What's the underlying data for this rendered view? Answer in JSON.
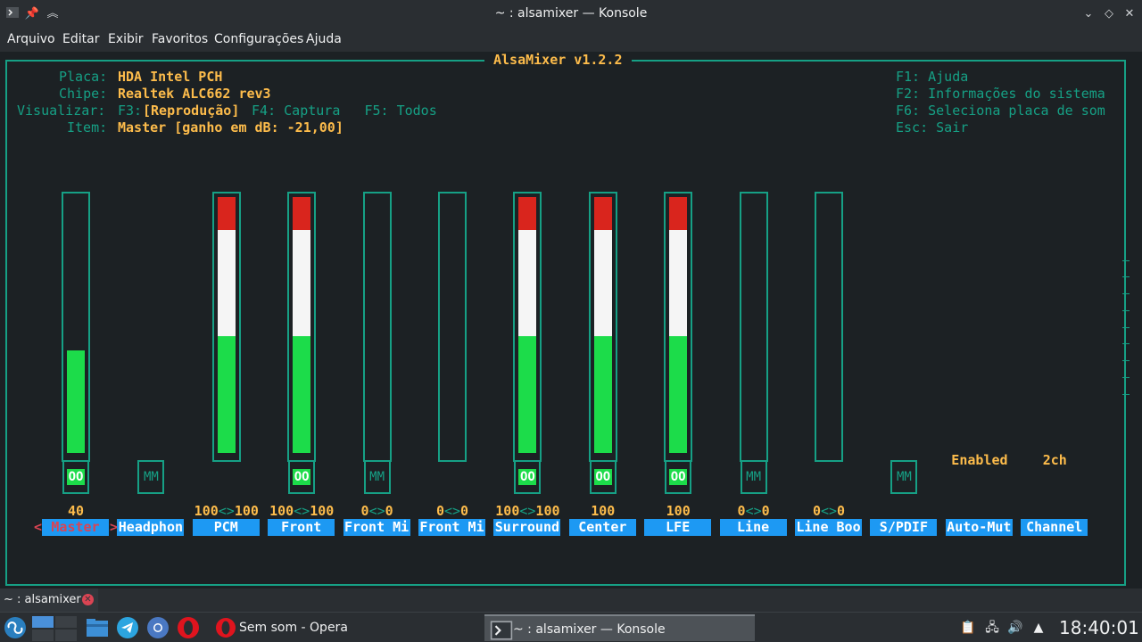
{
  "window": {
    "title": "~ : alsamixer — Konsole"
  },
  "menu": [
    "Arquivo",
    "Editar",
    "Exibir",
    "Favoritos",
    "Configurações",
    "Ajuda"
  ],
  "mixer": {
    "title": "AlsaMixer v1.2.2",
    "info": {
      "card_label": "Placa:",
      "card_value": "HDA Intel PCH",
      "chip_label": "Chipe:",
      "chip_value": "Realtek ALC662 rev3",
      "view_label": "Visualizar:",
      "view_f3": "F3:",
      "view_playback": "[Reprodução]",
      "view_others": " F4: Captura   F5: Todos",
      "item_label": "Item:",
      "item_value": "Master [ganho em dB: -21,00]"
    },
    "help": [
      "F1: Ajuda",
      "F2: Informações do sistema",
      "F6: Seleciona placa de som",
      "Esc: Sair"
    ],
    "channels": [
      {
        "name": "Master",
        "volume_text": "40",
        "level": 0.4,
        "mute": "OO",
        "selected": true
      },
      {
        "name": "Headphon",
        "volume_text": "",
        "level": null,
        "mute": "MM",
        "selected": false
      },
      {
        "name": "PCM",
        "volume_text": "100<>100",
        "level": 1.0,
        "mute": null,
        "selected": false
      },
      {
        "name": "Front",
        "volume_text": "100<>100",
        "level": 1.0,
        "mute": "OO",
        "selected": false
      },
      {
        "name": "Front Mi",
        "volume_text": "0<>0",
        "level": 0,
        "mute": "MM",
        "selected": false
      },
      {
        "name": "Front Mi",
        "volume_text": "0<>0",
        "level": 0,
        "mute": null,
        "selected": false
      },
      {
        "name": "Surround",
        "volume_text": "100<>100",
        "level": 1.0,
        "mute": "OO",
        "selected": false
      },
      {
        "name": "Center",
        "volume_text": "100",
        "level": 1.0,
        "mute": "OO",
        "selected": false
      },
      {
        "name": "LFE",
        "volume_text": "100",
        "level": 1.0,
        "mute": "OO",
        "selected": false
      },
      {
        "name": "Line",
        "volume_text": "0<>0",
        "level": 0,
        "mute": "MM",
        "selected": false
      },
      {
        "name": "Line Boo",
        "volume_text": "0<>0",
        "level": 0,
        "mute": null,
        "selected": false
      },
      {
        "name": "S/PDIF",
        "volume_text": "",
        "level": null,
        "mute": "MM",
        "selected": false
      },
      {
        "name": "Auto-Mut",
        "volume_text": "",
        "level": null,
        "mute": null,
        "enum_value": "Enabled",
        "selected": false
      },
      {
        "name": "Channel",
        "volume_text": "",
        "level": null,
        "mute": null,
        "enum_value": "2ch",
        "selected": false
      }
    ],
    "arrows": {
      "left": "<",
      "right": ">"
    }
  },
  "tabs": [
    {
      "label": "~ : alsamixer"
    }
  ],
  "taskbar": {
    "windows": [
      {
        "title": "Sem som - Opera"
      },
      {
        "title": "~ : alsamixer — Konsole"
      }
    ],
    "clock": "18:40:01"
  },
  "colors": {
    "frame": "#16a085",
    "value": "#fdbc4b",
    "label_bg": "#1d99f3",
    "green": "#1cdc4a",
    "red": "#d9251d"
  }
}
